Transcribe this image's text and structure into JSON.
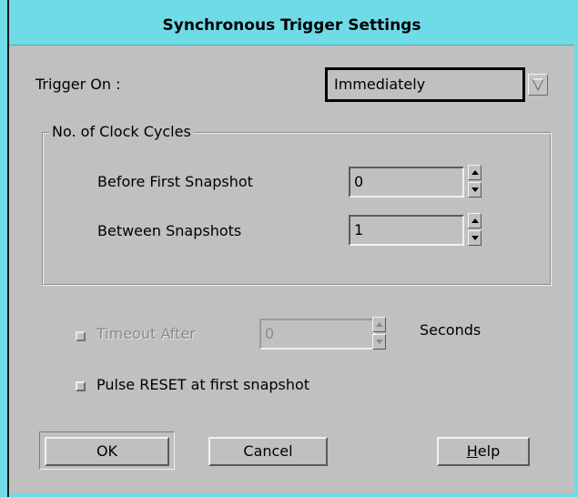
{
  "window": {
    "title": "Synchronous Trigger Settings"
  },
  "trigger": {
    "label": "Trigger On :",
    "selected": "Immediately",
    "dropdown_icon": "triangle-down-icon"
  },
  "clock_group": {
    "legend": "No. of Clock Cycles",
    "before_first": {
      "label": "Before First Snapshot",
      "value": "0"
    },
    "between": {
      "label": "Between Snapshots",
      "value": "1"
    }
  },
  "timeout": {
    "label": "Timeout After",
    "value": "0",
    "units": "Seconds",
    "enabled": false,
    "checked": false
  },
  "pulse_reset": {
    "label": "Pulse RESET at first snapshot",
    "checked": false
  },
  "buttons": {
    "ok": "OK",
    "cancel": "Cancel",
    "help_mnemonic": "H",
    "help_rest": "elp"
  },
  "colors": {
    "titlebar": "#6fdbe7",
    "dialog_bg": "#c0c0c0"
  }
}
